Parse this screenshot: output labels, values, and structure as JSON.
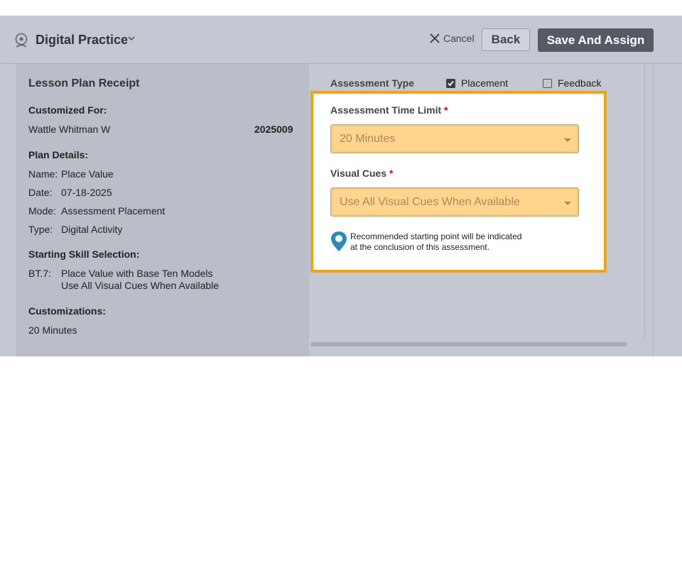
{
  "header": {
    "app_icon": "webcam-icon",
    "title": "Digital Practice",
    "cancel_label": "Cancel",
    "back_label": "Back",
    "save_label": "Save And Assign"
  },
  "receipt": {
    "title": "Lesson Plan Receipt",
    "customized_for_label": "Customized For:",
    "student_name": "Wattle Whitman W",
    "student_id": "2025009",
    "plan_details_label": "Plan Details:",
    "name_label": "Name:",
    "name_value": "Place Value",
    "date_label": "Date:",
    "date_value": "07-18-2025",
    "mode_label": "Mode:",
    "mode_value": "Assessment Placement",
    "type_label": "Type:",
    "type_value": "Digital Activity",
    "skill_label": "Starting Skill Selection:",
    "skill_code": "BT.7:",
    "skill_name": "Place Value with Base Ten Models",
    "skill_cue": "Use All Visual Cues When Available",
    "customizations_label": "Customizations:",
    "customization_value": "20 Minutes"
  },
  "form": {
    "assessment_type_label": "Assessment Type",
    "placement_label": "Placement",
    "placement_checked": true,
    "feedback_label": "Feedback",
    "feedback_checked": false,
    "time_limit_label": "Assessment Time Limit",
    "time_limit_value": "20 Minutes",
    "visual_cues_label": "Visual Cues",
    "visual_cues_value": "Use All Visual Cues When Available",
    "required_mark": "*",
    "note_line1": "Recommended starting point will be indicated",
    "note_line2": "at the conclusion of this assessment.",
    "highlight_color": "#f5a30a",
    "select_color": "#ffd58e",
    "pin_color": "#2a8ab8"
  }
}
